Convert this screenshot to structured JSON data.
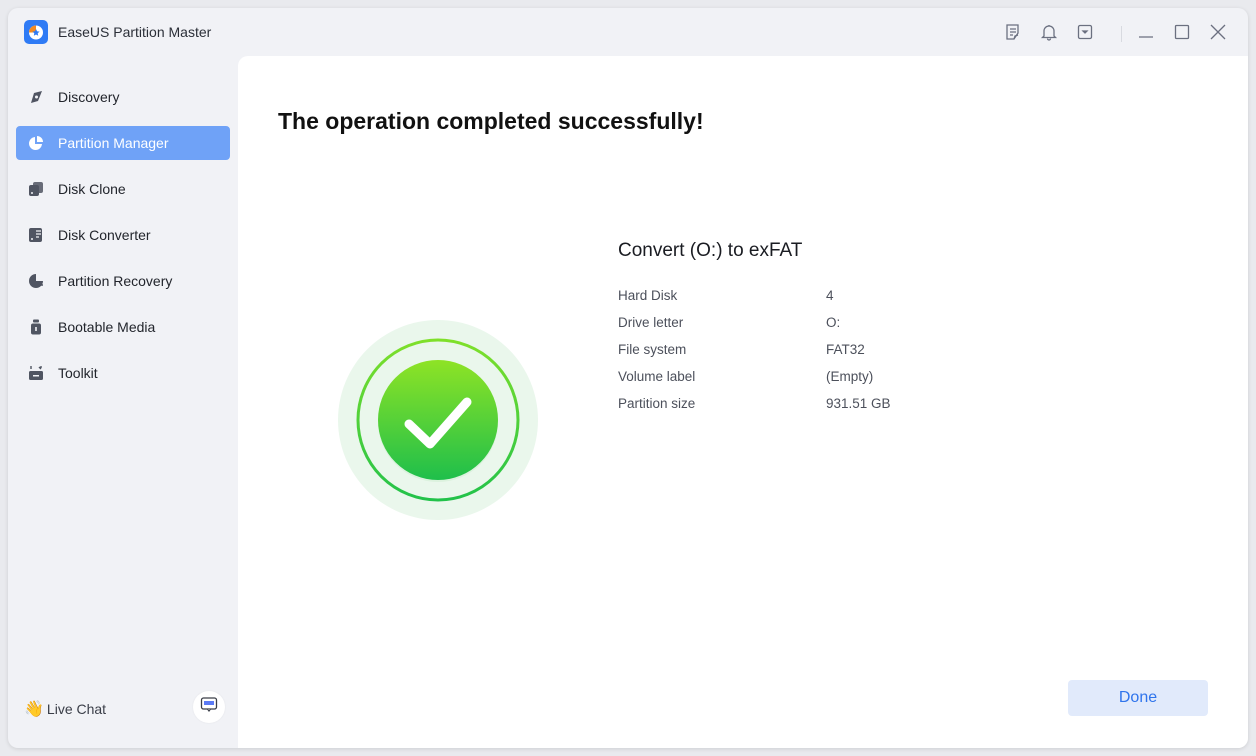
{
  "app": {
    "title": "EaseUS Partition Master"
  },
  "titlebar": {
    "icons": [
      "notes-icon",
      "bell-icon",
      "dropdown-icon",
      "minimize-icon",
      "maximize-icon",
      "close-icon"
    ]
  },
  "sidebar": {
    "items": [
      {
        "label": "Discovery",
        "icon": "compass-icon",
        "active": false
      },
      {
        "label": "Partition Manager",
        "icon": "pie-chart-icon",
        "active": true
      },
      {
        "label": "Disk Clone",
        "icon": "disk-clone-icon",
        "active": false
      },
      {
        "label": "Disk Converter",
        "icon": "disk-converter-icon",
        "active": false
      },
      {
        "label": "Partition Recovery",
        "icon": "partition-recovery-icon",
        "active": false
      },
      {
        "label": "Bootable Media",
        "icon": "usb-drive-icon",
        "active": false
      },
      {
        "label": "Toolkit",
        "icon": "toolkit-icon",
        "active": false
      }
    ],
    "live_chat": {
      "emoji": "👋",
      "label": "Live Chat"
    }
  },
  "main": {
    "headline": "The operation completed successfully!",
    "operation": {
      "title": "Convert (O:) to exFAT",
      "details": [
        {
          "key": "Hard Disk",
          "value": "4"
        },
        {
          "key": "Drive letter",
          "value": "O:"
        },
        {
          "key": "File system",
          "value": "FAT32"
        },
        {
          "key": "Volume label",
          "value": "(Empty)"
        },
        {
          "key": "Partition size",
          "value": "931.51 GB"
        }
      ]
    },
    "done_label": "Done"
  },
  "colors": {
    "accent": "#6fa2f7",
    "success_green": "#3cc83c",
    "done_text": "#2f74ec",
    "done_bg": "#e1eafb"
  }
}
